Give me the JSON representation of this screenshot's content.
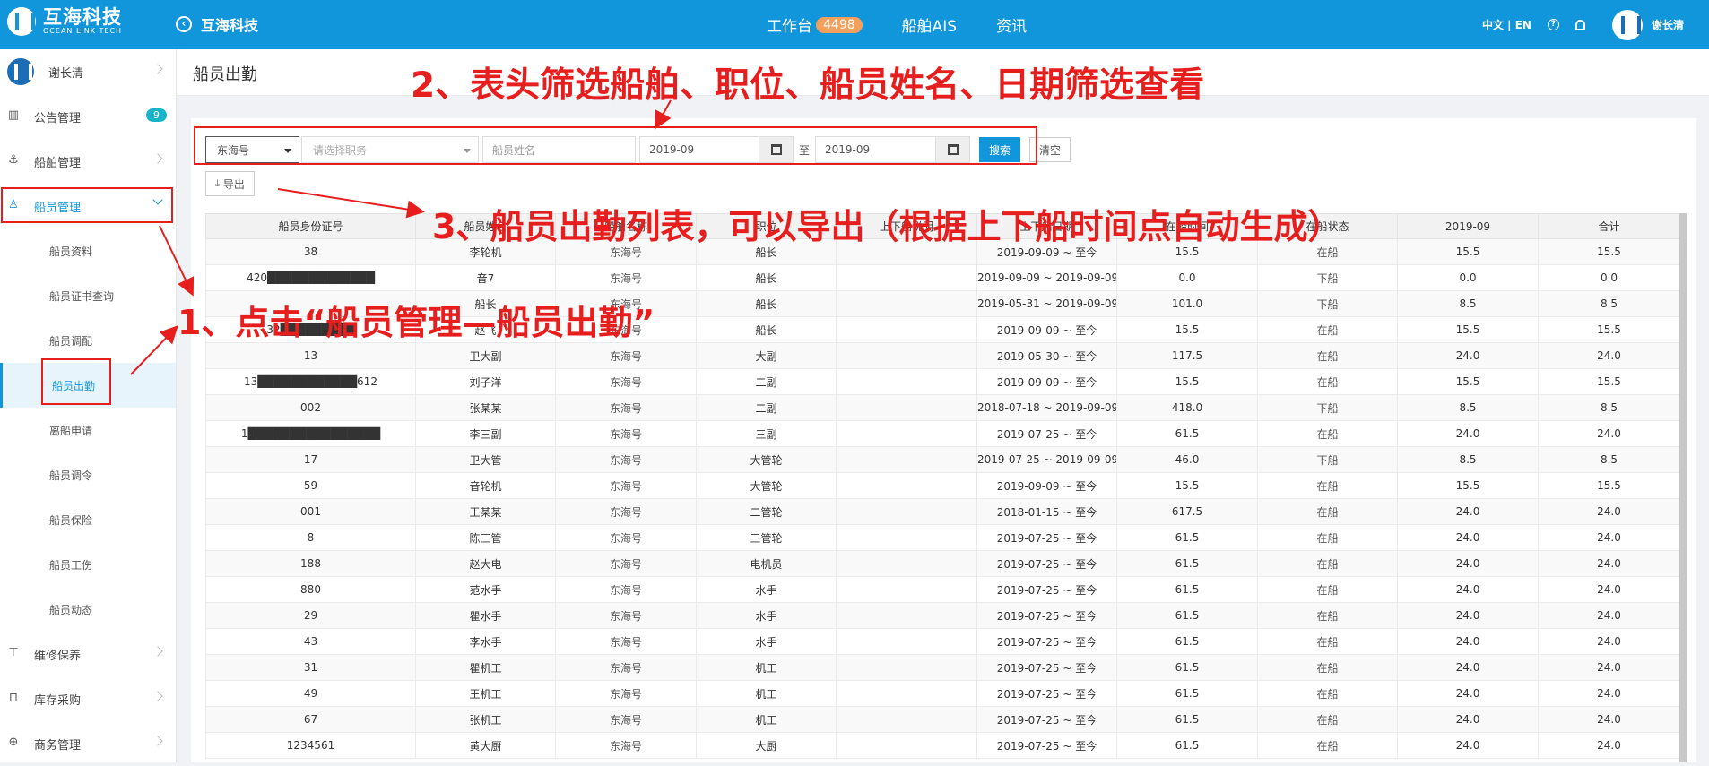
{
  "header": {
    "logo_cn": "互海科技",
    "logo_en": "OCEAN LINK TECH",
    "company": "互海科技",
    "nav": [
      {
        "label": "工作台",
        "badge": "4498"
      },
      {
        "label": "船舶AIS",
        "badge": null
      },
      {
        "label": "资讯",
        "badge": null
      }
    ],
    "lang": "中文 | EN",
    "user": "谢长清"
  },
  "sidebar": {
    "user": "谢长清",
    "items": [
      {
        "label": "公告管理",
        "badge": "9",
        "icon": "book-icon"
      },
      {
        "label": "船舶管理",
        "icon": "anchor-icon"
      },
      {
        "label": "船员管理",
        "icon": "user-icon"
      }
    ],
    "sub_items": [
      "船员资料",
      "船员证书查询",
      "船员调配",
      "船员出勤",
      "离船申请",
      "船员调令",
      "船员保险",
      "船员工伤",
      "船员动态"
    ],
    "bottom_items": [
      {
        "label": "维修保养",
        "icon": "wrench-icon"
      },
      {
        "label": "库存采购",
        "icon": "bag-icon"
      },
      {
        "label": "商务管理",
        "icon": "globe-icon"
      }
    ]
  },
  "page": {
    "title": "船员出勤"
  },
  "filters": {
    "ship": "东海号",
    "position_placeholder": "请选择职务",
    "name_placeholder": "船员姓名",
    "date_from": "2019-09",
    "to_label": "至",
    "date_to": "2019-09",
    "search": "搜索",
    "clear": "清空",
    "export": "导出"
  },
  "table": {
    "headers": [
      "船员身份证号",
      "船员姓名",
      "船舶名称",
      "职位",
      "上下船说明",
      "上下船日期",
      "在船时间",
      "在船状态",
      "2019-09",
      "合计"
    ],
    "rows": [
      [
        "38",
        "李轮机",
        "东海号",
        "船长",
        "",
        "2019-09-09 ~ 至今",
        "15.5",
        "在船",
        "15.5",
        "15.5"
      ],
      [
        "420█████████████",
        "音7",
        "东海号",
        "船长",
        "",
        "2019-09-09 ~ 2019-09-09",
        "0.0",
        "下船",
        "0.0",
        "0.0"
      ],
      [
        "",
        "船长",
        "东海号",
        "船长",
        "",
        "2019-05-31 ~ 2019-09-09",
        "101.0",
        "下船",
        "8.5",
        "8.5"
      ],
      [
        "32█████████",
        "赵飞",
        "东海号",
        "船长",
        "",
        "2019-09-09 ~ 至今",
        "15.5",
        "在船",
        "15.5",
        "15.5"
      ],
      [
        "13",
        "卫大副",
        "东海号",
        "大副",
        "",
        "2019-05-30 ~ 至今",
        "117.5",
        "在船",
        "24.0",
        "24.0"
      ],
      [
        "13████████████612",
        "刘子洋",
        "东海号",
        "二副",
        "",
        "2019-09-09 ~ 至今",
        "15.5",
        "在船",
        "15.5",
        "15.5"
      ],
      [
        "002",
        "张某某",
        "东海号",
        "二副",
        "",
        "2018-07-18 ~ 2019-09-09",
        "418.0",
        "下船",
        "8.5",
        "8.5"
      ],
      [
        "1████████████████",
        "李三副",
        "东海号",
        "三副",
        "",
        "2019-07-25 ~ 至今",
        "61.5",
        "在船",
        "24.0",
        "24.0"
      ],
      [
        "17",
        "卫大管",
        "东海号",
        "大管轮",
        "",
        "2019-07-25 ~ 2019-09-09",
        "46.0",
        "下船",
        "8.5",
        "8.5"
      ],
      [
        "59",
        "音轮机",
        "东海号",
        "大管轮",
        "",
        "2019-09-09 ~ 至今",
        "15.5",
        "在船",
        "15.5",
        "15.5"
      ],
      [
        "001",
        "王某某",
        "东海号",
        "二管轮",
        "",
        "2018-01-15 ~ 至今",
        "617.5",
        "在船",
        "24.0",
        "24.0"
      ],
      [
        "8",
        "陈三管",
        "东海号",
        "三管轮",
        "",
        "2019-07-25 ~ 至今",
        "61.5",
        "在船",
        "24.0",
        "24.0"
      ],
      [
        "188",
        "赵大电",
        "东海号",
        "电机员",
        "",
        "2019-07-25 ~ 至今",
        "61.5",
        "在船",
        "24.0",
        "24.0"
      ],
      [
        "880",
        "范水手",
        "东海号",
        "水手",
        "",
        "2019-07-25 ~ 至今",
        "61.5",
        "在船",
        "24.0",
        "24.0"
      ],
      [
        "29",
        "瞿水手",
        "东海号",
        "水手",
        "",
        "2019-07-25 ~ 至今",
        "61.5",
        "在船",
        "24.0",
        "24.0"
      ],
      [
        "43",
        "李水手",
        "东海号",
        "水手",
        "",
        "2019-07-25 ~ 至今",
        "61.5",
        "在船",
        "24.0",
        "24.0"
      ],
      [
        "31",
        "瞿机工",
        "东海号",
        "机工",
        "",
        "2019-07-25 ~ 至今",
        "61.5",
        "在船",
        "24.0",
        "24.0"
      ],
      [
        "49",
        "王机工",
        "东海号",
        "机工",
        "",
        "2019-07-25 ~ 至今",
        "61.5",
        "在船",
        "24.0",
        "24.0"
      ],
      [
        "67",
        "张机工",
        "东海号",
        "机工",
        "",
        "2019-07-25 ~ 至今",
        "61.5",
        "在船",
        "24.0",
        "24.0"
      ],
      [
        "1234561",
        "黄大厨",
        "东海号",
        "大厨",
        "",
        "2019-07-25 ~ 至今",
        "61.5",
        "在船",
        "24.0",
        "24.0"
      ]
    ]
  },
  "annotations": {
    "step1": "1、点击“船员管理—船员出勤”",
    "step2": "2、表头筛选船舶、职位、船员姓名、日期筛选查看",
    "step3": "3、船员出勤列表，可以导出（根据上下船时间点自动生成）"
  }
}
